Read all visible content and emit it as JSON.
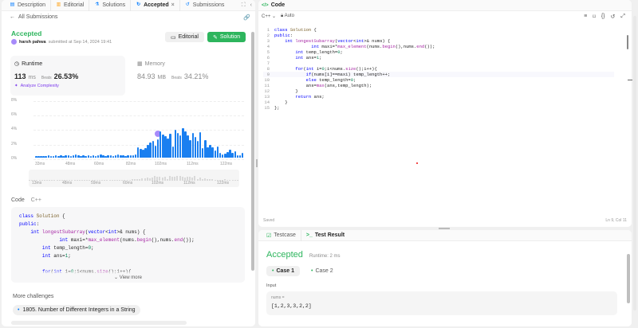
{
  "left_tabs": [
    {
      "label": "Description",
      "icon": "description-icon"
    },
    {
      "label": "Editorial",
      "icon": "editorial-icon"
    },
    {
      "label": "Solutions",
      "icon": "solutions-icon"
    },
    {
      "label": "Accepted",
      "icon": "accepted-icon",
      "close": "×"
    },
    {
      "label": "Submissions",
      "icon": "submissions-icon"
    }
  ],
  "back_link": "All Submissions",
  "status": "Accepted",
  "author": "harsh pahwa",
  "submitted_text": "submitted at Sep 14, 2024 19:41",
  "editorial_button": "Editorial",
  "solution_button": "Solution",
  "runtime": {
    "label": "Runtime",
    "value": "113",
    "unit": "ms",
    "beats_label": "Beats",
    "beats": "26.53%",
    "analyze": "Analyze Complexity"
  },
  "memory": {
    "label": "Memory",
    "value": "84.93",
    "unit": "MB",
    "beats_label": "Beats",
    "beats": "34.21%"
  },
  "chart_data": {
    "type": "bar",
    "y_ticks": [
      "8%",
      "6%",
      "4%",
      "2%",
      "0%"
    ],
    "x_ticks": [
      "33ms",
      "48ms",
      "60ms",
      "82ms",
      "102ms",
      "112ms",
      "122ms"
    ],
    "mini_ticks": [
      "13ms",
      "48ms",
      "59ms",
      "60ms",
      "102ms",
      "112ms",
      "122ms"
    ],
    "values": [
      0.2,
      0.2,
      0.2,
      0.2,
      0.2,
      0.3,
      0.2,
      0.2,
      0.3,
      0.2,
      0.3,
      0.2,
      0.3,
      0.3,
      0.2,
      0.3,
      0.4,
      0.3,
      0.2,
      0.3,
      0.2,
      0.3,
      0.2,
      0.3,
      0.2,
      0.3,
      0.4,
      0.3,
      0.2,
      0.3,
      0.3,
      0.2,
      0.3,
      0.4,
      0.3,
      0.3,
      0.2,
      0.3,
      0.3,
      0.3,
      0.4,
      1.3,
      1.1,
      1.0,
      1.2,
      1.6,
      1.9,
      2.1,
      1.5,
      2.3,
      3.3,
      2.9,
      2.7,
      2.4,
      3.0,
      1.4,
      3.5,
      3.1,
      2.8,
      3.7,
      3.3,
      2.8,
      2.2,
      3.1,
      2.6,
      2.1,
      3.2,
      1.2,
      2.2,
      1.3,
      1.6,
      1.3,
      0.9,
      1.4,
      0.6,
      0.4,
      0.5,
      0.7,
      1.0,
      0.6,
      0.8,
      0.3,
      0.3,
      0.6
    ],
    "highlight_index": 49,
    "ylim": [
      0,
      8
    ]
  },
  "code_section": {
    "label": "Code",
    "lang": "C++"
  },
  "code_preview": [
    "class Solution {",
    "public:",
    "    int longestSubarray(vector<int>& nums) {",
    "              int maxi=*max_element(nums.begin(),nums.end());",
    "        int temp_length=0;",
    "        int ans=1;",
    "",
    "        for(int i=0;i<nums.size();i++){"
  ],
  "view_more": "View more",
  "more_challenges": "More challenges",
  "challenge_1": "1805. Number of Different Integers in a String",
  "code_panel": {
    "title": "Code",
    "lang": "C++",
    "auto": "Auto",
    "saved": "Saved",
    "position": "Ln 9, Col 11"
  },
  "editor_lines": [
    "class Solution {",
    "public:",
    "    int longestSubarray(vector<int>& nums) {",
    "              int maxi=*max_element(nums.begin(),nums.end());",
    "        int temp_length=0;",
    "        int ans=1;",
    "",
    "        for(int i=0;i<nums.size();i++){",
    "            if(nums[i]==maxi) temp_length++;",
    "            else temp_length=0;",
    "            ans=max(ans,temp_length);",
    "        }",
    "        return ans;",
    "    }",
    "};"
  ],
  "bottom_tabs": [
    {
      "label": "Testcase"
    },
    {
      "label": "Test Result"
    }
  ],
  "result_status": "Accepted",
  "result_runtime": "Runtime: 2 ms",
  "cases": [
    "Case 1",
    "Case 2"
  ],
  "input_label": "Input",
  "input_var": "nums =",
  "input_value": "[1,2,3,3,2,2]"
}
